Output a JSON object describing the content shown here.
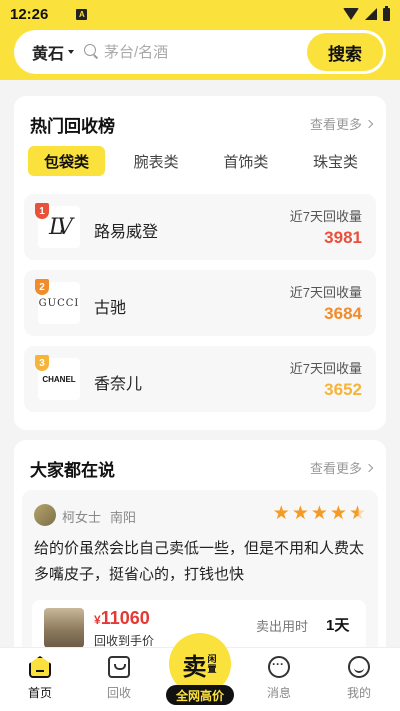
{
  "status_bar": {
    "time": "12:26",
    "app_indicator": "A"
  },
  "header": {
    "city": "黄石",
    "search_placeholder": "茅台/名酒",
    "search_button": "搜索"
  },
  "ranking": {
    "title": "热门回收榜",
    "more": "查看更多",
    "tabs": [
      {
        "label": "包袋类",
        "active": true
      },
      {
        "label": "腕表类",
        "active": false
      },
      {
        "label": "首饰类",
        "active": false
      },
      {
        "label": "珠宝类",
        "active": false
      }
    ],
    "items": [
      {
        "rank": "1",
        "logo": "LV",
        "name": "路易威登",
        "metric_label": "近7天回收量",
        "count": "3981",
        "rank_color": "#e8513a"
      },
      {
        "rank": "2",
        "logo": "GUCCI",
        "name": "古驰",
        "metric_label": "近7天回收量",
        "count": "3684",
        "rank_color": "#f08c2b"
      },
      {
        "rank": "3",
        "logo": "CHANEL",
        "name": "香奈儿",
        "metric_label": "近7天回收量",
        "count": "3652",
        "rank_color": "#f5b43a"
      }
    ]
  },
  "reviews": {
    "title": "大家都在说",
    "more": "查看更多",
    "review": {
      "user": "柯女士",
      "city": "南阳",
      "rating": 4.5,
      "text": "给的价虽然会比自己卖低一些，但是不用和人费太多嘴皮子，挺省心的，打钱也快",
      "price_symbol": "¥",
      "price": "11060",
      "price_note": "回收到手价",
      "sold_label": "卖出用时",
      "sold_value": "1天"
    }
  },
  "bottom_nav": {
    "items": [
      {
        "label": "首页",
        "icon": "home-icon",
        "active": true
      },
      {
        "label": "回收",
        "icon": "recycle-icon",
        "active": false
      },
      {
        "label": "消息",
        "icon": "message-icon",
        "active": false
      },
      {
        "label": "我的",
        "icon": "profile-icon",
        "active": false
      }
    ],
    "sell": {
      "main": "卖",
      "sub": "闲置",
      "tag": "全网高价"
    }
  },
  "colors": {
    "accent": "#fbe13b",
    "price_red": "#e53935",
    "star": "#f59a23"
  }
}
